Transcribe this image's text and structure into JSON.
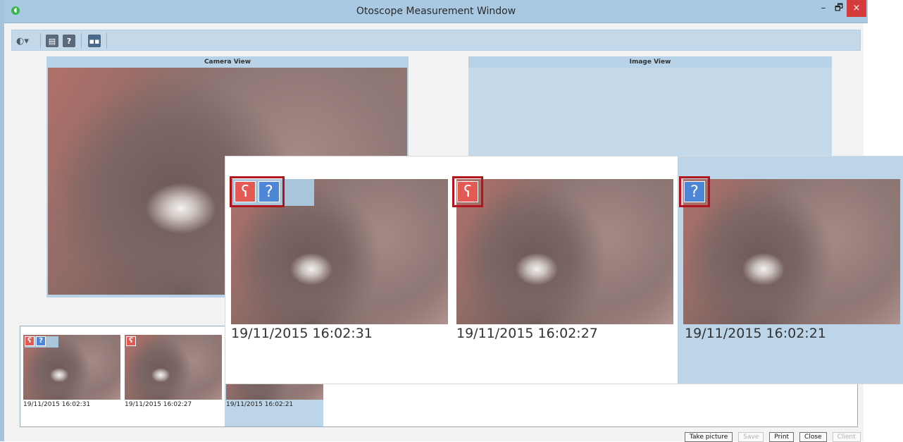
{
  "window": {
    "title": "Otoscope Measurement Window",
    "controls": {
      "minimize": "–",
      "maximize": "🗗",
      "close": "×"
    }
  },
  "toolbar": {
    "menu_icon": "theme-dropdown-icon",
    "save_icon": "save-icon",
    "help_icon": "help-icon",
    "help_glyph": "?",
    "layout_icon": "layout-icon"
  },
  "camera_view": {
    "title": "Camera View"
  },
  "image_view": {
    "title": "Image View"
  },
  "thumbnails": [
    {
      "date": "19/11/2015 16:02:31",
      "badges": [
        "left",
        "right"
      ],
      "selected": false
    },
    {
      "date": "19/11/2015 16:02:27",
      "badges": [
        "left"
      ],
      "selected": false
    },
    {
      "date": "19/11/2015 16:02:21",
      "badges": [
        "right"
      ],
      "selected": true
    }
  ],
  "zoom_callout": {
    "tiles": [
      {
        "date": "19/11/2015 16:02:31",
        "badges": [
          "left",
          "right"
        ]
      },
      {
        "date": "19/11/2015 16:02:27",
        "badges": [
          "left"
        ]
      },
      {
        "date": "19/11/2015 16:02:21",
        "badges": [
          "right"
        ]
      }
    ]
  },
  "buttons": {
    "take_picture": "Take picture",
    "save": "Save",
    "print": "Print",
    "close": "Close",
    "client": "Client"
  },
  "colors": {
    "left_ear": "#e35a55",
    "right_ear": "#4d86d6",
    "highlight": "#b2151b",
    "selection": "#bcd5e8"
  }
}
